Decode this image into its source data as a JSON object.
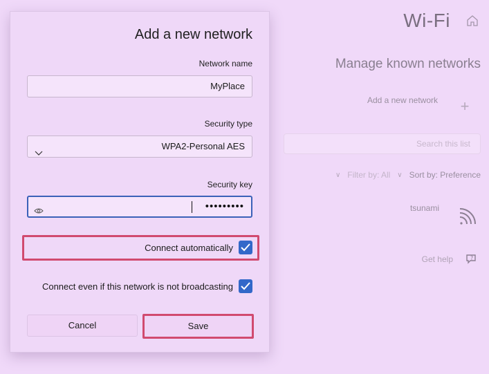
{
  "background": {
    "title": "Wi-Fi",
    "subtitle": "Manage known networks",
    "add_network_label": "Add a new network",
    "add_icon": "plus-icon",
    "search_placeholder": "Search this list",
    "sort_label": "Sort by: Preference",
    "filter_label": "Filter by: All",
    "network_name": "tsunami",
    "help_label": "Get help"
  },
  "dialog": {
    "title": "Add a new network",
    "network_name_label": "Network name",
    "network_name_value": "MyPlace",
    "security_type_label": "Security type",
    "security_type_value": "WPA2-Personal AES",
    "security_key_label": "Security key",
    "security_key_value": "•••••••••",
    "connect_auto_label": "Connect automatically",
    "connect_auto_checked": true,
    "connect_hidden_label": "Connect even if this network is not broadcasting",
    "connect_hidden_checked": true,
    "save_label": "Save",
    "cancel_label": "Cancel"
  },
  "colors": {
    "background": "#f0d9f9",
    "accent": "#3268c9",
    "highlight": "#d14a6f",
    "focus_border": "#3a61b8"
  }
}
